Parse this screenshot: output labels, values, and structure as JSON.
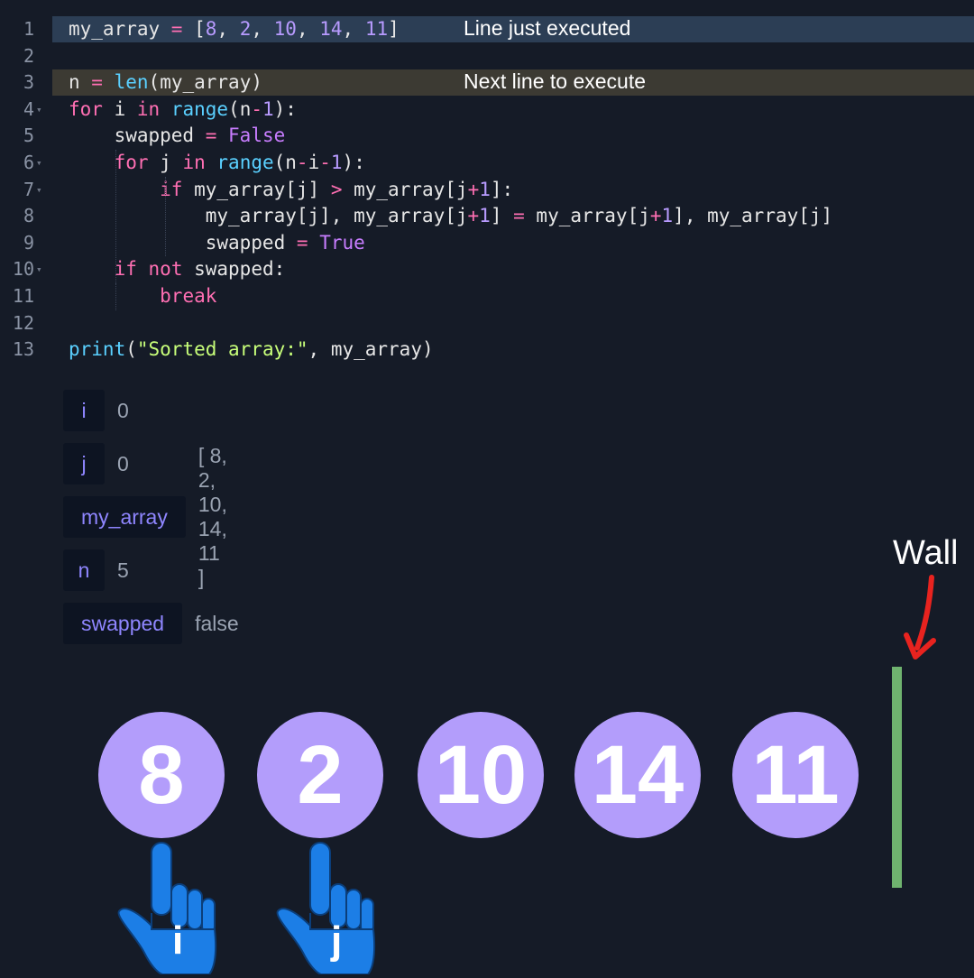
{
  "editor": {
    "lines": [
      {
        "n": "1",
        "fold": false,
        "state": "executed"
      },
      {
        "n": "2",
        "fold": false,
        "state": ""
      },
      {
        "n": "3",
        "fold": false,
        "state": "next"
      },
      {
        "n": "4",
        "fold": true,
        "state": ""
      },
      {
        "n": "5",
        "fold": false,
        "state": ""
      },
      {
        "n": "6",
        "fold": true,
        "state": ""
      },
      {
        "n": "7",
        "fold": true,
        "state": ""
      },
      {
        "n": "8",
        "fold": false,
        "state": ""
      },
      {
        "n": "9",
        "fold": false,
        "state": ""
      },
      {
        "n": "10",
        "fold": true,
        "state": ""
      },
      {
        "n": "11",
        "fold": false,
        "state": ""
      },
      {
        "n": "12",
        "fold": false,
        "state": ""
      },
      {
        "n": "13",
        "fold": false,
        "state": ""
      }
    ],
    "code": [
      [
        [
          "",
          "my_array "
        ],
        [
          "op",
          "="
        ],
        [
          "",
          " ["
        ],
        [
          "num",
          "8"
        ],
        [
          "",
          ", "
        ],
        [
          "num",
          "2"
        ],
        [
          "",
          ", "
        ],
        [
          "num",
          "10"
        ],
        [
          "",
          ", "
        ],
        [
          "num",
          "14"
        ],
        [
          "",
          ", "
        ],
        [
          "num",
          "11"
        ],
        [
          "",
          "]"
        ]
      ],
      [],
      [
        [
          "",
          "n "
        ],
        [
          "op",
          "="
        ],
        [
          "",
          " "
        ],
        [
          "fn",
          "len"
        ],
        [
          "",
          "(my_array)"
        ]
      ],
      [
        [
          "kw",
          "for"
        ],
        [
          "",
          " i "
        ],
        [
          "kw",
          "in"
        ],
        [
          "",
          " "
        ],
        [
          "fn",
          "range"
        ],
        [
          "",
          "(n"
        ],
        [
          "op",
          "-"
        ],
        [
          "num",
          "1"
        ],
        [
          "",
          "):"
        ]
      ],
      [
        [
          "",
          "    swapped "
        ],
        [
          "op",
          "="
        ],
        [
          "",
          " "
        ],
        [
          "bool",
          "False"
        ]
      ],
      [
        [
          "",
          "    "
        ],
        [
          "kw",
          "for"
        ],
        [
          "",
          " j "
        ],
        [
          "kw",
          "in"
        ],
        [
          "",
          " "
        ],
        [
          "fn",
          "range"
        ],
        [
          "",
          "(n"
        ],
        [
          "op",
          "-"
        ],
        [
          "",
          "i"
        ],
        [
          "op",
          "-"
        ],
        [
          "num",
          "1"
        ],
        [
          "",
          "):"
        ]
      ],
      [
        [
          "",
          "        "
        ],
        [
          "kw",
          "if"
        ],
        [
          "",
          " my_array[j] "
        ],
        [
          "op",
          ">"
        ],
        [
          "",
          " my_array[j"
        ],
        [
          "op",
          "+"
        ],
        [
          "num",
          "1"
        ],
        [
          "",
          "]:"
        ]
      ],
      [
        [
          "",
          "            my_array[j], my_array[j"
        ],
        [
          "op",
          "+"
        ],
        [
          "num",
          "1"
        ],
        [
          "",
          "] "
        ],
        [
          "op",
          "="
        ],
        [
          "",
          " my_array[j"
        ],
        [
          "op",
          "+"
        ],
        [
          "num",
          "1"
        ],
        [
          "",
          "], my_array[j]"
        ]
      ],
      [
        [
          "",
          "            swapped "
        ],
        [
          "op",
          "="
        ],
        [
          "",
          " "
        ],
        [
          "bool",
          "True"
        ]
      ],
      [
        [
          "",
          "    "
        ],
        [
          "kw",
          "if"
        ],
        [
          "",
          " "
        ],
        [
          "kw",
          "not"
        ],
        [
          "",
          " swapped:"
        ]
      ],
      [
        [
          "",
          "        "
        ],
        [
          "kw",
          "break"
        ]
      ],
      [],
      [
        [
          "fn",
          "print"
        ],
        [
          "",
          "("
        ],
        [
          "str",
          "\"Sorted array:\""
        ],
        [
          "",
          ", my_array)"
        ]
      ]
    ],
    "note_executed": "Line just executed",
    "note_next": "Next line to execute"
  },
  "variables": [
    {
      "name": "i",
      "value": "0"
    },
    {
      "name": "j",
      "value": "0"
    },
    {
      "name": "my_array",
      "value": "[ 8, 2, 10, 14, 11 ]"
    },
    {
      "name": "n",
      "value": "5"
    },
    {
      "name": "swapped",
      "value": "false"
    }
  ],
  "visual": {
    "array": [
      "8",
      "2",
      "10",
      "14",
      "11"
    ],
    "pointer_i": {
      "label": "i",
      "index": 0
    },
    "pointer_j": {
      "label": "j",
      "index": 1
    },
    "wall_label": "Wall",
    "colors": {
      "circle": "#b39dfb",
      "wall": "#6fb36f",
      "hand": "#1c7ee6",
      "arrow": "#e8231f"
    }
  }
}
